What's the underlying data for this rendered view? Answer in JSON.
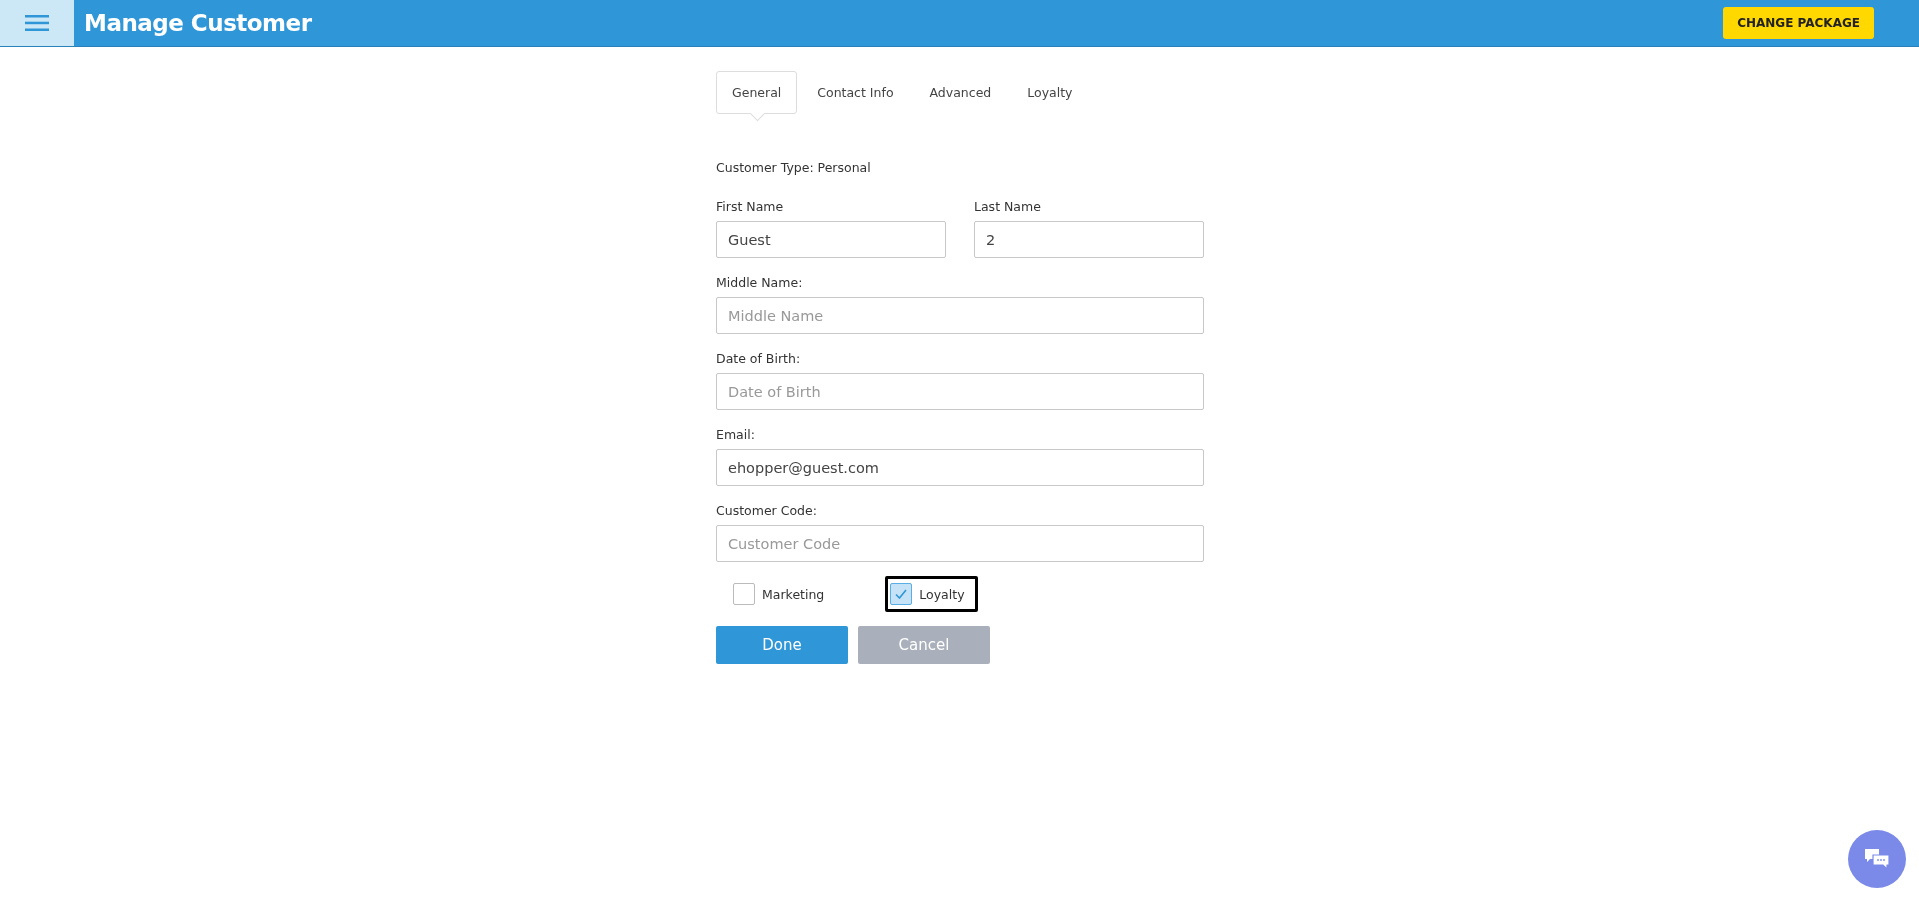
{
  "header": {
    "title": "Manage Customer",
    "action": "CHANGE PACKAGE"
  },
  "tabs": [
    {
      "label": "General",
      "selected": true
    },
    {
      "label": "Contact Info",
      "selected": false
    },
    {
      "label": "Advanced",
      "selected": false
    },
    {
      "label": "Loyalty",
      "selected": false
    }
  ],
  "customer_type": "Customer Type: Personal",
  "name_fields": [
    {
      "label": "First Name",
      "value": "Guest"
    },
    {
      "label": "Last Name",
      "value": "2"
    }
  ],
  "fields": [
    {
      "label": "Middle Name:",
      "placeholder": "Middle Name"
    },
    {
      "label": "Date of Birth:",
      "placeholder": "Date of Birth"
    },
    {
      "label": "Email:",
      "value": "ehopper@guest.com"
    },
    {
      "label": "Customer Code:",
      "placeholder": "Customer Code"
    }
  ],
  "checkboxes": [
    {
      "label": "Marketing",
      "checked": false,
      "focused": false
    },
    {
      "label": "Loyalty",
      "checked": true,
      "focused": true
    }
  ],
  "buttons": [
    {
      "label": "Done",
      "disabled": false
    },
    {
      "label": "Cancel",
      "disabled": true
    }
  ]
}
